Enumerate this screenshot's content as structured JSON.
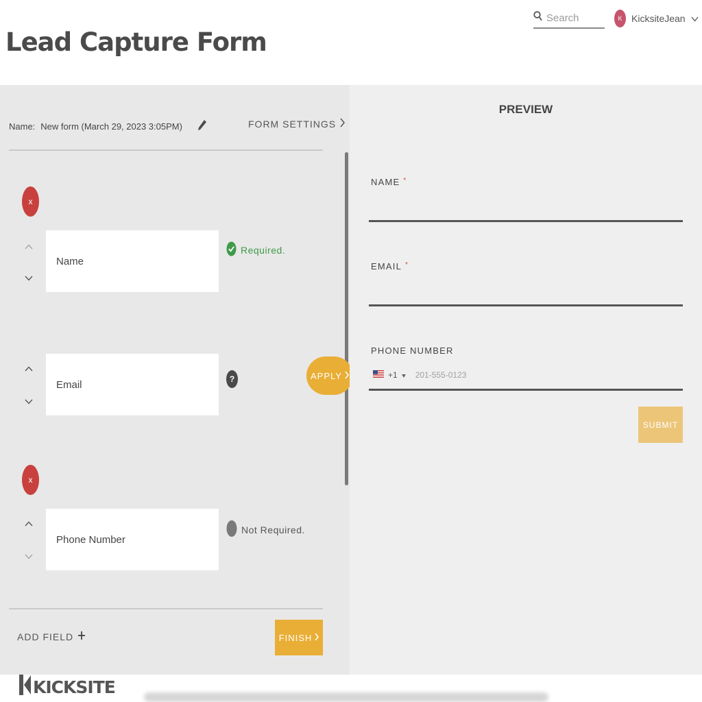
{
  "header": {
    "title": "Lead Capture Form",
    "search_placeholder": "Search",
    "user_initial": "K",
    "username": "KicksiteJean"
  },
  "form_panel": {
    "name_label": "Name:",
    "name_value": "New form (March 29, 2023  3:05PM)",
    "settings_label": "FORM SETTINGS",
    "fields": [
      {
        "label": "Name",
        "required_text": "Required.",
        "status": "required",
        "removable": true
      },
      {
        "label": "Email",
        "required_text": "?",
        "status": "locked",
        "removable": false
      },
      {
        "label": "Phone Number",
        "required_text": "Not Required.",
        "status": "not-required",
        "removable": true
      }
    ],
    "delete_symbol": "x",
    "apply_label": "APPLY",
    "add_field_label": "ADD FIELD",
    "finish_label": "FINISH"
  },
  "preview": {
    "title": "PREVIEW",
    "fields": [
      {
        "label": "NAME",
        "required": "*"
      },
      {
        "label": "EMAIL",
        "required": "*"
      },
      {
        "label": "PHONE NUMBER"
      }
    ],
    "phone_code": "+1",
    "phone_placeholder": "201-555-0123",
    "submit_label": "SUBMIT"
  },
  "brand": {
    "logo_text": "KICKSITE"
  },
  "colors": {
    "accent": "#e9ae35",
    "delete": "#c8413e",
    "required_check": "#3f9a4a",
    "left_panel": "#e8e8e8",
    "right_panel": "#efefef"
  }
}
